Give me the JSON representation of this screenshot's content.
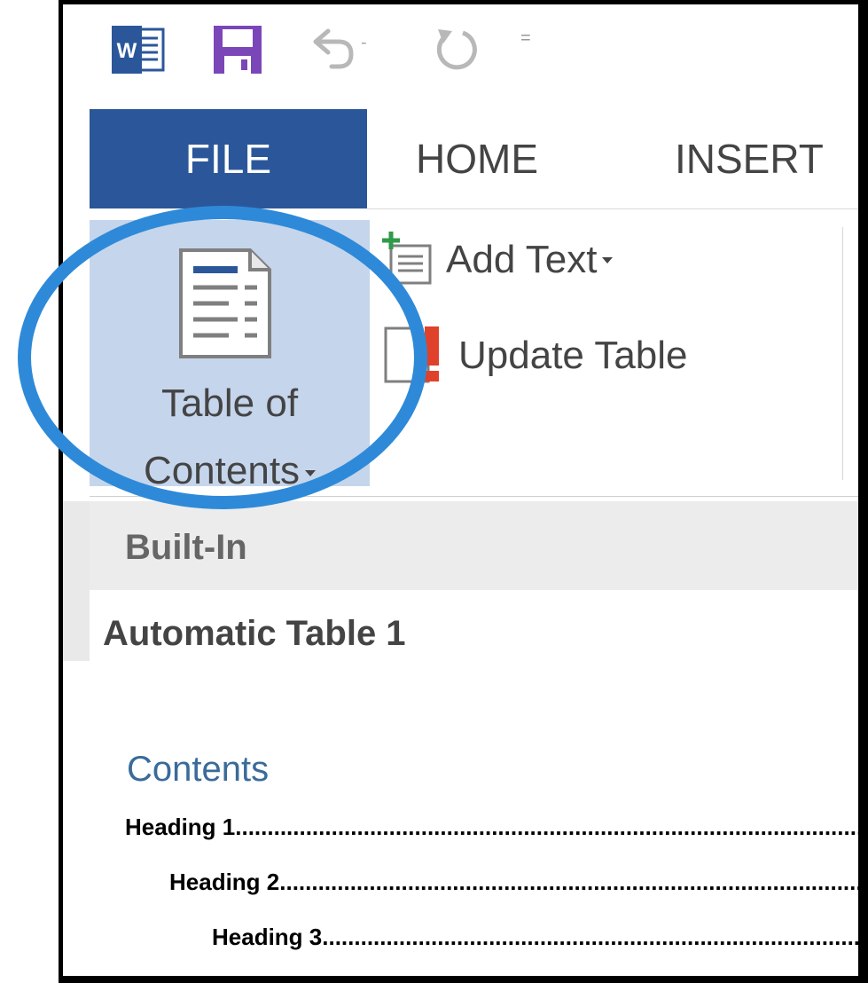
{
  "qat": {
    "word_icon": "word-logo-icon",
    "save_icon": "save-icon",
    "undo_icon": "undo-icon",
    "undo_dropdown": "-",
    "redo_icon": "redo-icon",
    "customize": "="
  },
  "tabs": [
    {
      "label": "FILE"
    },
    {
      "label": "HOME"
    },
    {
      "label": "INSERT"
    }
  ],
  "ribbon": {
    "toc_button": {
      "line1": "Table of",
      "line2": "Contents",
      "icon": "table-of-contents-icon"
    },
    "add_text": {
      "label": "Add Text",
      "icon": "add-text-icon"
    },
    "update_table": {
      "label": "Update Table",
      "icon": "update-table-icon"
    }
  },
  "gallery": {
    "section_header": "Built-In",
    "item_title": "Automatic Table 1",
    "preview": {
      "contents_title": "Contents",
      "lines": [
        {
          "text": "Heading 1",
          "leader": ".................................................................................................................."
        },
        {
          "text": "Heading 2",
          "leader": ".................................................................................................................."
        },
        {
          "text": "Heading 3",
          "leader": ".................................................................................................................."
        }
      ]
    }
  },
  "colors": {
    "file_tab": "#2b579a",
    "toc_highlight": "#c5d5ec",
    "annotation_circle": "#2e8ad8",
    "contents_title": "#3a6b9a"
  }
}
